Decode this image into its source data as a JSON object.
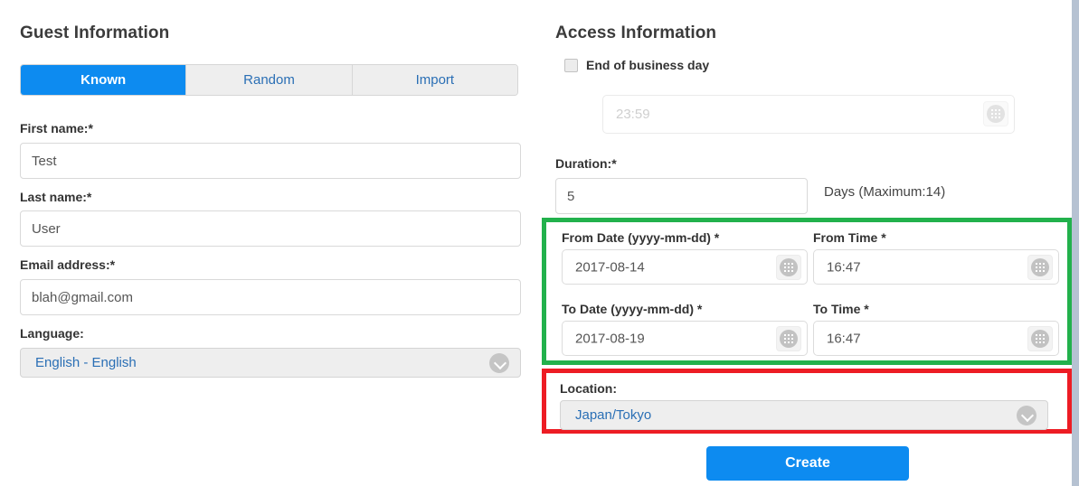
{
  "guest": {
    "section_title": "Guest Information",
    "tabs": [
      {
        "label": "Known",
        "active": true
      },
      {
        "label": "Random",
        "active": false
      },
      {
        "label": "Import",
        "active": false
      }
    ],
    "first_name": {
      "label": "First name:*",
      "value": "Test",
      "placeholder": ""
    },
    "last_name": {
      "label": "Last name:*",
      "value": "User",
      "placeholder": ""
    },
    "email": {
      "label": "Email address:*",
      "value": "blah@gmail.com",
      "placeholder": ""
    },
    "language": {
      "label": "Language:",
      "value": "English - English",
      "icon": "chevron-down-icon"
    }
  },
  "access": {
    "section_title": "Access Information",
    "end_of_business_day": {
      "label": "End of business day",
      "checked": false
    },
    "eob_time": {
      "value": "",
      "placeholder": "23:59",
      "icon": "calendar-icon",
      "disabled": true
    },
    "duration": {
      "label": "Duration:*",
      "value": "5",
      "note": "Days (Maximum:14)"
    },
    "from_date": {
      "label": "From Date (yyyy-mm-dd) *",
      "value": "2017-08-14",
      "icon": "calendar-icon"
    },
    "from_time": {
      "label": "From Time *",
      "value": "16:47",
      "icon": "calendar-icon"
    },
    "to_date": {
      "label": "To Date (yyyy-mm-dd) *",
      "value": "2017-08-19",
      "icon": "calendar-icon"
    },
    "to_time": {
      "label": "To Time *",
      "value": "16:47",
      "icon": "calendar-icon"
    },
    "location": {
      "label": "Location:",
      "value": "Japan/Tokyo",
      "icon": "chevron-down-icon"
    },
    "create_button": "Create"
  },
  "highlights": {
    "datetime_box_color": "#22b14c",
    "location_box_color": "#ed1c24"
  },
  "colors": {
    "accent_blue": "#0d8bf0",
    "link_blue": "#2a6fb5",
    "tab_inactive_bg": "#eeeeee",
    "select_bg": "#eeeeee",
    "scrollbar_thumb": "#b6c2d2"
  }
}
